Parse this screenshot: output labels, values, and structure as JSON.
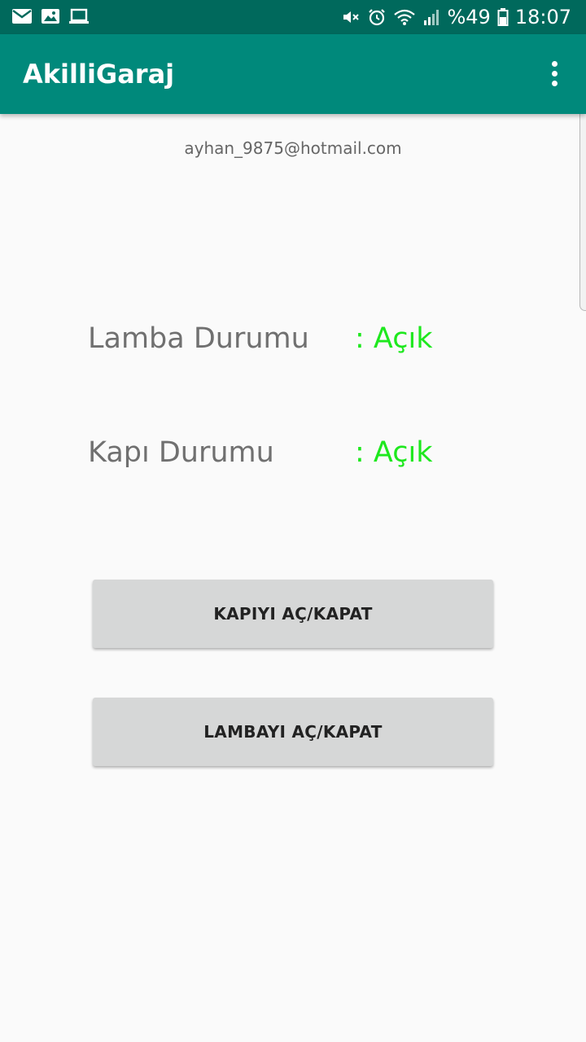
{
  "status_bar": {
    "left_icons": [
      "mail-icon",
      "image-icon",
      "laptop-icon"
    ],
    "right_icons": [
      "mute-icon",
      "alarm-icon",
      "wifi-icon",
      "signal-icon"
    ],
    "battery_text": "%49",
    "time": "18:07",
    "color": "#00695c"
  },
  "app_bar": {
    "title": "AkilliGaraj",
    "menu_icon": "more-vert-icon",
    "color": "#00897b"
  },
  "main": {
    "email": "ayhan_9875@hotmail.com",
    "lamp_status": {
      "label": "Lamba Durumu",
      "value": ": Açık"
    },
    "door_status": {
      "label": "Kapı Durumu",
      "value": ": Açık"
    },
    "status_color": "#1ee81e"
  },
  "buttons": {
    "door_toggle": "KAPIYI AÇ/KAPAT",
    "lamp_toggle": "LAMBAYI AÇ/KAPAT"
  }
}
